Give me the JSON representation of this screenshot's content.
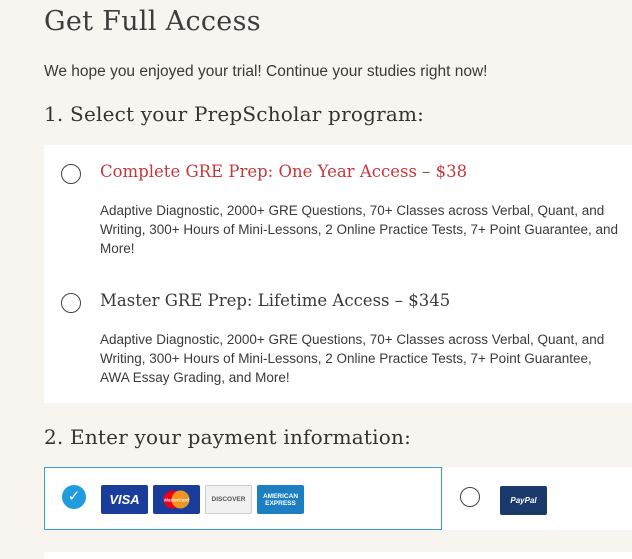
{
  "page": {
    "title": "Get Full Access",
    "subtitle": "We hope you enjoyed your trial! Continue your studies right now!"
  },
  "step1": {
    "heading": "1. Select your PrepScholar program:",
    "options": [
      {
        "title": "Complete GRE Prep: One Year Access – $38",
        "description": "Adaptive Diagnostic, 2000+ GRE Questions, 70+ Classes across Verbal, Quant, and Writing, 300+ Hours of Mini-Lessons, 2 Online Practice Tests, 7+ Point Guarantee, and More!",
        "selected": false,
        "title_color": "#c8373b"
      },
      {
        "title": "Master GRE Prep: Lifetime Access – $345",
        "description": "Adaptive Diagnostic, 2000+ GRE Questions, 70+ Classes across Verbal, Quant, and Writing, 300+ Hours of Mini-Lessons, 2 Online Practice Tests, 7+ Point Guarantee, AWA Essay Grading, and More!",
        "selected": false
      }
    ]
  },
  "step2": {
    "heading": "2. Enter your payment information:",
    "methods": [
      {
        "name": "card",
        "selected": true,
        "logos": {
          "visa": "VISA",
          "mastercard": "MasterCard",
          "discover": "DISCOVER",
          "amex": "AMERICAN EXPRESS"
        }
      },
      {
        "name": "paypal",
        "selected": false,
        "logo": "PayPal"
      }
    ]
  },
  "colors": {
    "accent_red": "#c8373b",
    "accent_blue": "#1f9bde",
    "background": "#f8f4ef"
  }
}
